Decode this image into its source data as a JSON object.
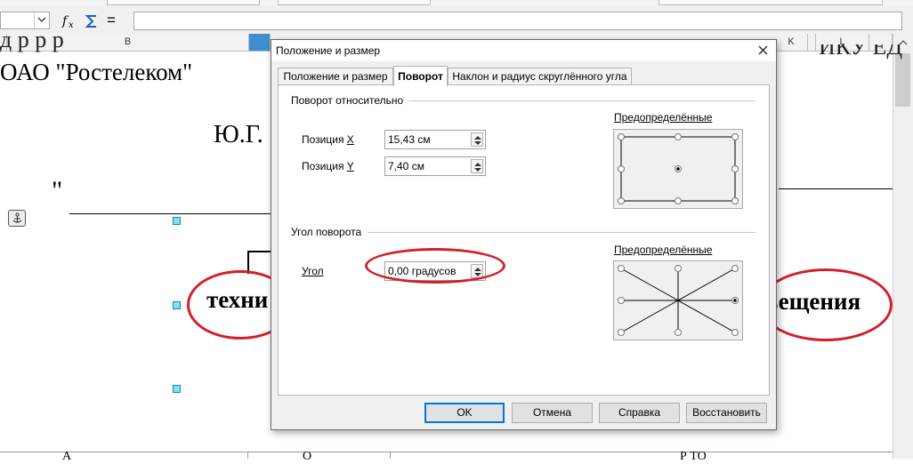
{
  "formula_bar": {
    "fx_icon": "function-wizard-icon",
    "sum_icon": "sum-icon",
    "equals_label": "="
  },
  "columns": {
    "b": "B",
    "k": "K",
    "l": "L"
  },
  "sheet": {
    "ooo_text": "ОАО \"Ростелеком\"",
    "initials_text": "Ю.Г.",
    "quote_text": "\"",
    "tech_text": "техни",
    "vesh_text": "вещения",
    "cut_left_text": "д  р       р                р",
    "cut_right_text": "ИКУ  ЕД",
    "bottom_text_1": "А",
    "bottom_text_2": "О",
    "bottom_text_3": "Р    ТО"
  },
  "dialog": {
    "title": "Положение и размер",
    "tabs": [
      {
        "label": "Положение и размер",
        "active": false
      },
      {
        "label": "Поворот",
        "active": true
      },
      {
        "label": "Наклон и радиус скруглённого угла",
        "active": false
      }
    ],
    "rotation_group": {
      "title": "Поворот относительно",
      "pos_x_label": "Позиция ",
      "pos_x_key": "X",
      "pos_x_value": "15,43 см",
      "pos_y_label": "Позиция ",
      "pos_y_key": "Y",
      "pos_y_value": "7,40 см",
      "predefined_label": "Предопределённые"
    },
    "angle_group": {
      "title": "Угол поворота",
      "angle_label": "Угол",
      "angle_value": "0,00 градусов",
      "predefined_label": "Предопределённые"
    },
    "buttons": {
      "ok": "OK",
      "cancel": "Отмена",
      "help": "Справка",
      "reset": "Восстановить"
    }
  },
  "colors": {
    "annotation_red": "#d0202a",
    "selected_column": "#3e8ed0",
    "default_button_border": "#0078d7"
  }
}
